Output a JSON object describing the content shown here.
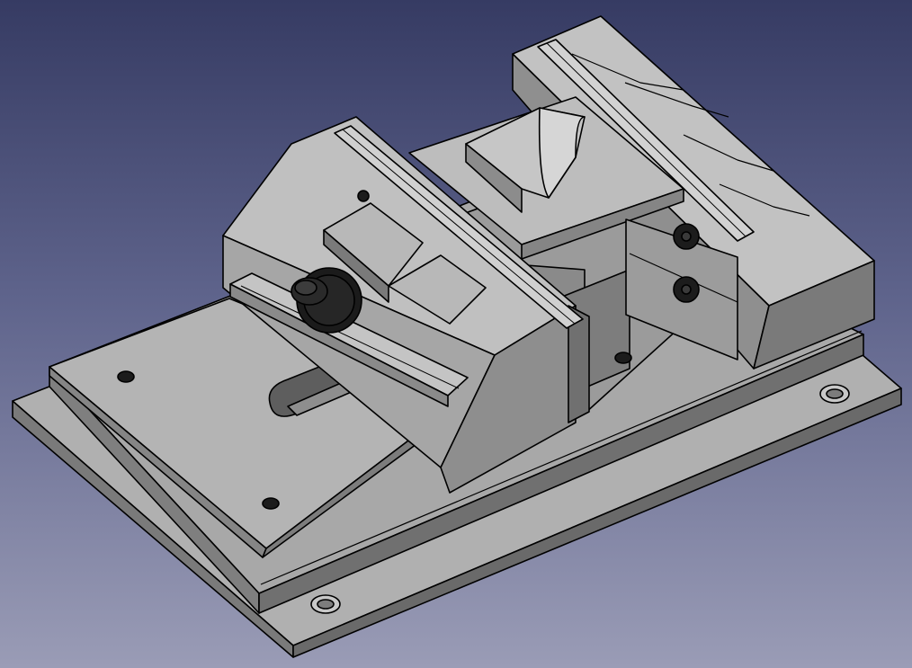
{
  "viewport": {
    "background_top": "#363b63",
    "background_bottom": "#9a9cb6"
  },
  "model": {
    "edge_color": "#000000",
    "face_light": "#b9b9b9",
    "face_mid": "#9e9e9e",
    "face_dark": "#6e6e6e",
    "hardware_color": "#1c1c1c"
  }
}
